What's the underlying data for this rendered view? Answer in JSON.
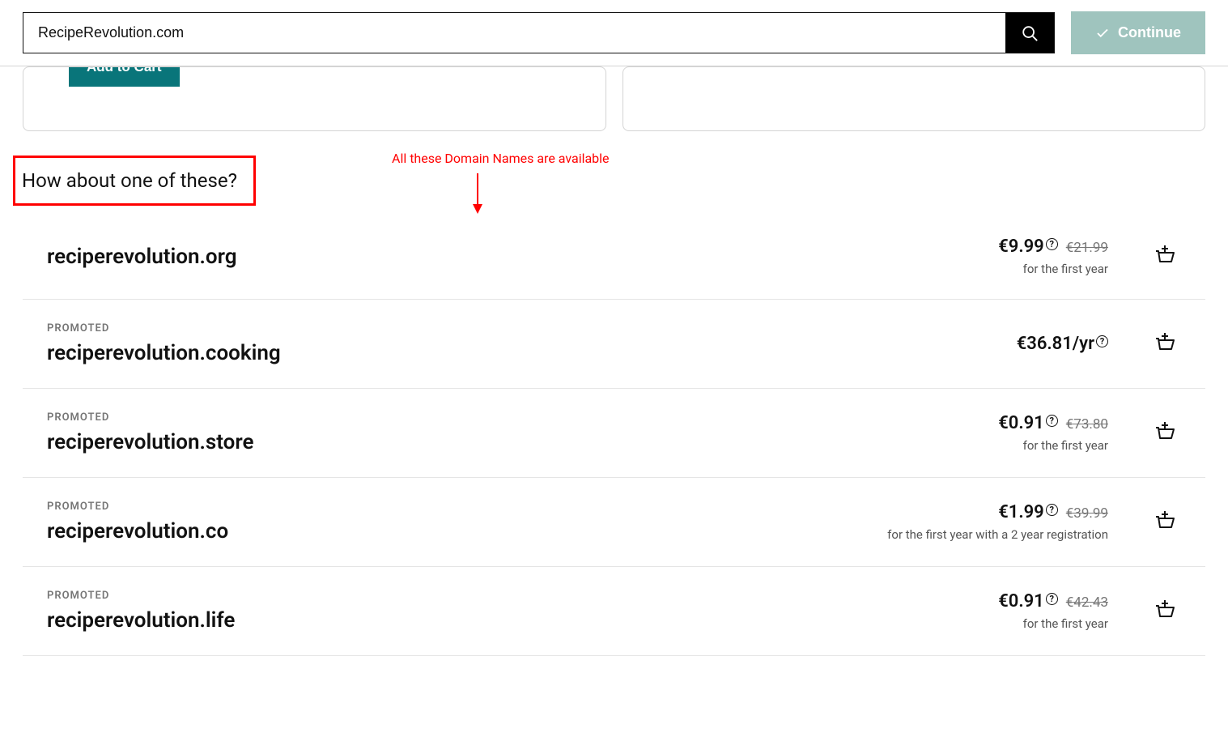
{
  "search": {
    "value": "RecipeRevolution.com"
  },
  "continue_label": "Continue",
  "card": {
    "add_to_cart": "Add to Cart"
  },
  "heading": "How about one of these?",
  "annotation": "All these Domain Names are available",
  "promoted_label": "Promoted",
  "help_glyph": "?",
  "domains": [
    {
      "name": "reciperevolution.org",
      "promoted": false,
      "price": "€9.99",
      "show_info": true,
      "strike": "€21.99",
      "sub": "for the first year"
    },
    {
      "name": "reciperevolution.cooking",
      "promoted": true,
      "price": "€36.81/yr",
      "show_info": true,
      "strike": "",
      "sub": ""
    },
    {
      "name": "reciperevolution.store",
      "promoted": true,
      "price": "€0.91",
      "show_info": true,
      "strike": "€73.80",
      "sub": "for the first year"
    },
    {
      "name": "reciperevolution.co",
      "promoted": true,
      "price": "€1.99",
      "show_info": true,
      "strike": "€39.99",
      "sub": "for the first year with a 2 year registration"
    },
    {
      "name": "reciperevolution.life",
      "promoted": true,
      "price": "€0.91",
      "show_info": true,
      "strike": "€42.43",
      "sub": "for the first year"
    }
  ]
}
